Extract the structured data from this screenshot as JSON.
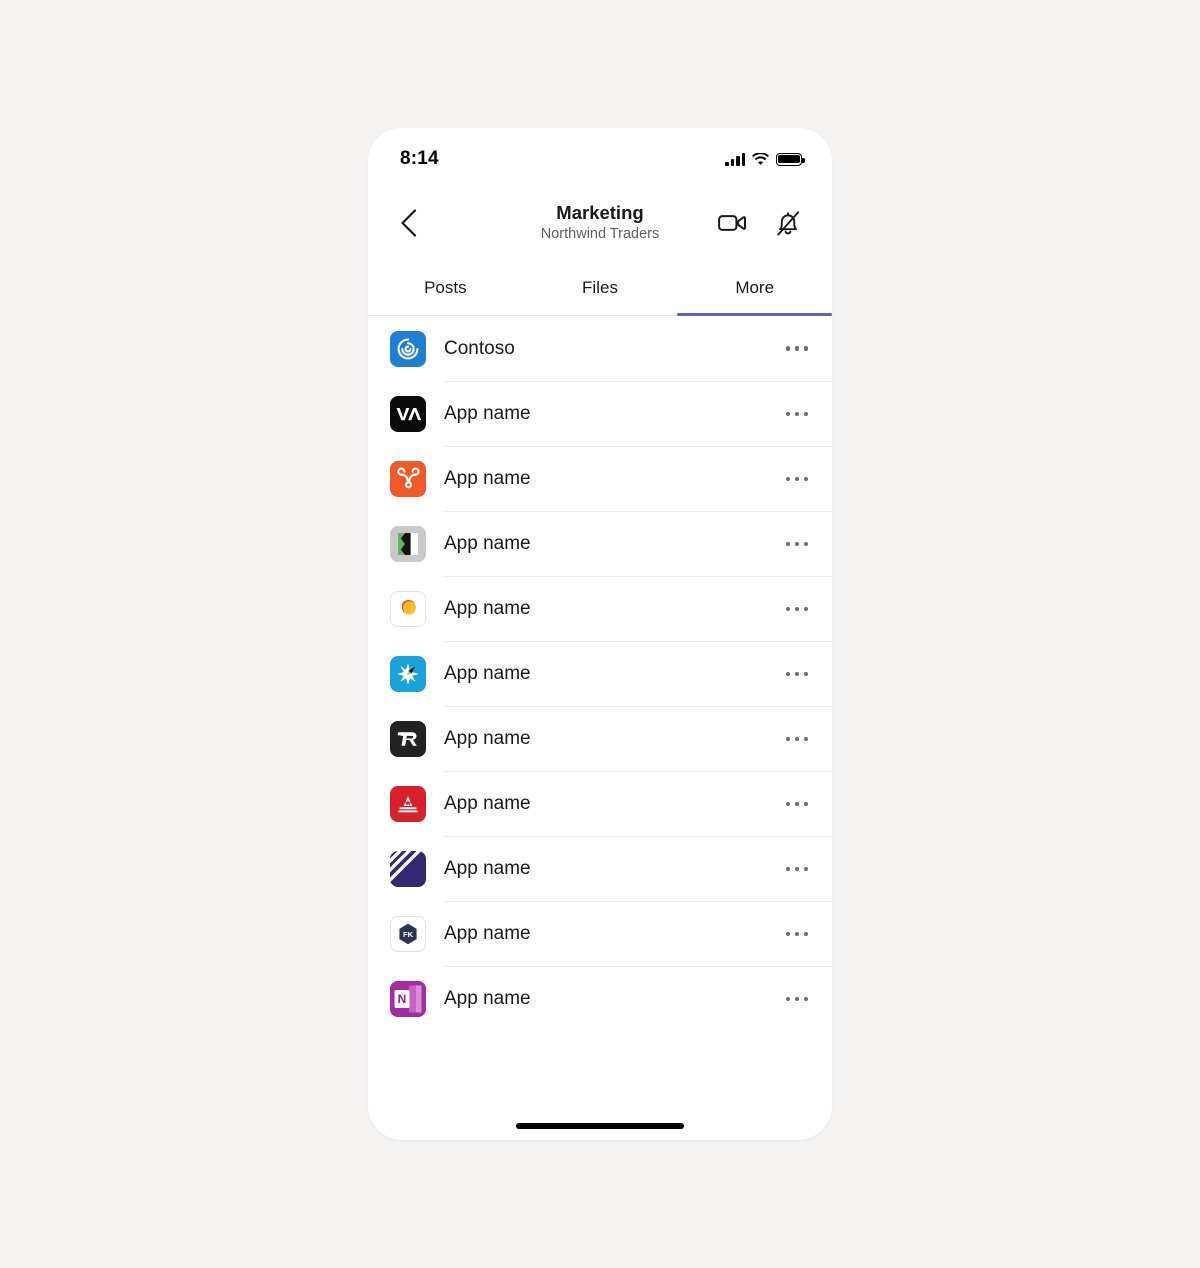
{
  "theme": {
    "accent": "#5b5fc7",
    "page_background": "#f4f3f2",
    "phone_background": "#ffffff",
    "text_primary": "#1b1a19",
    "text_secondary": "#616161",
    "divider": "#e9e9e9"
  },
  "status_bar": {
    "time": "8:14",
    "cellular_icon": "signal-bars-icon",
    "wifi_icon": "wifi-icon",
    "battery_icon": "battery-full-icon"
  },
  "header": {
    "back_icon": "chevron-left-icon",
    "title": "Marketing",
    "subtitle": "Northwind Traders",
    "actions": [
      {
        "name": "video-call-button",
        "icon": "video-camera-icon"
      },
      {
        "name": "mute-notifications-button",
        "icon": "bell-slash-icon"
      }
    ]
  },
  "tabs": {
    "active_index": 2,
    "items": [
      {
        "label": "Posts",
        "name": "tab-posts"
      },
      {
        "label": "Files",
        "name": "tab-files"
      },
      {
        "label": "More",
        "name": "tab-more"
      }
    ]
  },
  "app_list": {
    "overflow_icon": "more-horizontal-icon",
    "items": [
      {
        "label": "Contoso",
        "icon": "contoso-spiral-icon",
        "icon_bg": "#1d7fd6"
      },
      {
        "label": "App name",
        "icon": "va-monogram-icon",
        "icon_bg": "#0a0a0a"
      },
      {
        "label": "App name",
        "icon": "orange-knot-icon",
        "icon_bg": "#f05a28"
      },
      {
        "label": "App name",
        "icon": "green-black-flag-icon",
        "icon_bg": "#c9c9c9"
      },
      {
        "label": "App name",
        "icon": "yellow-blob-icon",
        "icon_bg": "#ffffff"
      },
      {
        "label": "App name",
        "icon": "blue-starburst-icon",
        "icon_bg": "#19a3dc"
      },
      {
        "label": "App name",
        "icon": "r-monogram-icon",
        "icon_bg": "#222222"
      },
      {
        "label": "App name",
        "icon": "red-mountain-icon",
        "icon_bg": "#d6202a"
      },
      {
        "label": "App name",
        "icon": "purple-stripes-icon",
        "icon_bg": "#33296e"
      },
      {
        "label": "App name",
        "icon": "fk-hexagon-icon",
        "icon_bg": "#ffffff"
      },
      {
        "label": "App name",
        "icon": "onenote-icon",
        "icon_bg": "#a32ba3"
      }
    ]
  },
  "home_indicator": {
    "name": "home-indicator"
  }
}
